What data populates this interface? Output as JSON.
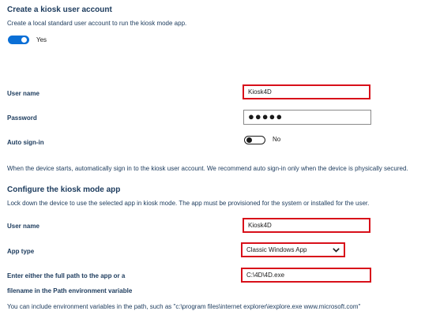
{
  "section1": {
    "title": "Create a kiosk user account",
    "description": "Create a local standard user account to run the kiosk mode app.",
    "toggle_label": "Yes"
  },
  "user_account": {
    "username_label": "User name",
    "username_value": "Kiosk4D",
    "password_label": "Password",
    "password_mask": "●●●●●",
    "auto_signin_label": "Auto sign-in",
    "auto_signin_state": "No",
    "auto_signin_note": "When the device starts, automatically sign in to the kiosk user account. We recommend auto sign-in only when the device is physically secured."
  },
  "section2": {
    "title": "Configure the kiosk mode app",
    "description": "Lock down the device to use the selected app in kiosk mode. The app must be provisioned for the system or installed for the user."
  },
  "app_config": {
    "username_label": "User name",
    "username_value": "Kiosk4D",
    "app_type_label": "App type",
    "app_type_value": "Classic Windows App",
    "path_label_line1": "Enter either the full path to the app or a",
    "path_label_line2": "filename in the Path environment variable",
    "path_value": "C:\\4D\\4D.exe",
    "path_note": "You can include environment variables in the path, such as \"c:\\program files\\internet explorer\\iexplore.exe www.microsoft.com\""
  },
  "colors": {
    "accent": "#0a6fd6",
    "highlight_border": "#d8101a",
    "label_text": "#1b3a5c"
  },
  "icons": {
    "dropdown": "chevron-down-icon"
  }
}
